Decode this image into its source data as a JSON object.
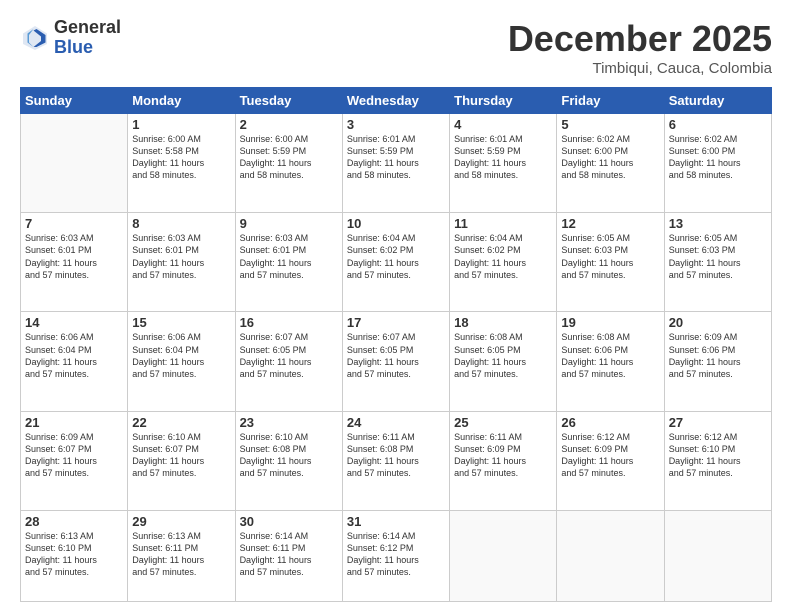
{
  "logo": {
    "general": "General",
    "blue": "Blue"
  },
  "title": "December 2025",
  "subtitle": "Timbiqui, Cauca, Colombia",
  "days_of_week": [
    "Sunday",
    "Monday",
    "Tuesday",
    "Wednesday",
    "Thursday",
    "Friday",
    "Saturday"
  ],
  "weeks": [
    [
      {
        "day": "",
        "info": ""
      },
      {
        "day": "1",
        "info": "Sunrise: 6:00 AM\nSunset: 5:58 PM\nDaylight: 11 hours\nand 58 minutes."
      },
      {
        "day": "2",
        "info": "Sunrise: 6:00 AM\nSunset: 5:59 PM\nDaylight: 11 hours\nand 58 minutes."
      },
      {
        "day": "3",
        "info": "Sunrise: 6:01 AM\nSunset: 5:59 PM\nDaylight: 11 hours\nand 58 minutes."
      },
      {
        "day": "4",
        "info": "Sunrise: 6:01 AM\nSunset: 5:59 PM\nDaylight: 11 hours\nand 58 minutes."
      },
      {
        "day": "5",
        "info": "Sunrise: 6:02 AM\nSunset: 6:00 PM\nDaylight: 11 hours\nand 58 minutes."
      },
      {
        "day": "6",
        "info": "Sunrise: 6:02 AM\nSunset: 6:00 PM\nDaylight: 11 hours\nand 58 minutes."
      }
    ],
    [
      {
        "day": "7",
        "info": "Sunrise: 6:03 AM\nSunset: 6:01 PM\nDaylight: 11 hours\nand 57 minutes."
      },
      {
        "day": "8",
        "info": "Sunrise: 6:03 AM\nSunset: 6:01 PM\nDaylight: 11 hours\nand 57 minutes."
      },
      {
        "day": "9",
        "info": "Sunrise: 6:03 AM\nSunset: 6:01 PM\nDaylight: 11 hours\nand 57 minutes."
      },
      {
        "day": "10",
        "info": "Sunrise: 6:04 AM\nSunset: 6:02 PM\nDaylight: 11 hours\nand 57 minutes."
      },
      {
        "day": "11",
        "info": "Sunrise: 6:04 AM\nSunset: 6:02 PM\nDaylight: 11 hours\nand 57 minutes."
      },
      {
        "day": "12",
        "info": "Sunrise: 6:05 AM\nSunset: 6:03 PM\nDaylight: 11 hours\nand 57 minutes."
      },
      {
        "day": "13",
        "info": "Sunrise: 6:05 AM\nSunset: 6:03 PM\nDaylight: 11 hours\nand 57 minutes."
      }
    ],
    [
      {
        "day": "14",
        "info": "Sunrise: 6:06 AM\nSunset: 6:04 PM\nDaylight: 11 hours\nand 57 minutes."
      },
      {
        "day": "15",
        "info": "Sunrise: 6:06 AM\nSunset: 6:04 PM\nDaylight: 11 hours\nand 57 minutes."
      },
      {
        "day": "16",
        "info": "Sunrise: 6:07 AM\nSunset: 6:05 PM\nDaylight: 11 hours\nand 57 minutes."
      },
      {
        "day": "17",
        "info": "Sunrise: 6:07 AM\nSunset: 6:05 PM\nDaylight: 11 hours\nand 57 minutes."
      },
      {
        "day": "18",
        "info": "Sunrise: 6:08 AM\nSunset: 6:05 PM\nDaylight: 11 hours\nand 57 minutes."
      },
      {
        "day": "19",
        "info": "Sunrise: 6:08 AM\nSunset: 6:06 PM\nDaylight: 11 hours\nand 57 minutes."
      },
      {
        "day": "20",
        "info": "Sunrise: 6:09 AM\nSunset: 6:06 PM\nDaylight: 11 hours\nand 57 minutes."
      }
    ],
    [
      {
        "day": "21",
        "info": "Sunrise: 6:09 AM\nSunset: 6:07 PM\nDaylight: 11 hours\nand 57 minutes."
      },
      {
        "day": "22",
        "info": "Sunrise: 6:10 AM\nSunset: 6:07 PM\nDaylight: 11 hours\nand 57 minutes."
      },
      {
        "day": "23",
        "info": "Sunrise: 6:10 AM\nSunset: 6:08 PM\nDaylight: 11 hours\nand 57 minutes."
      },
      {
        "day": "24",
        "info": "Sunrise: 6:11 AM\nSunset: 6:08 PM\nDaylight: 11 hours\nand 57 minutes."
      },
      {
        "day": "25",
        "info": "Sunrise: 6:11 AM\nSunset: 6:09 PM\nDaylight: 11 hours\nand 57 minutes."
      },
      {
        "day": "26",
        "info": "Sunrise: 6:12 AM\nSunset: 6:09 PM\nDaylight: 11 hours\nand 57 minutes."
      },
      {
        "day": "27",
        "info": "Sunrise: 6:12 AM\nSunset: 6:10 PM\nDaylight: 11 hours\nand 57 minutes."
      }
    ],
    [
      {
        "day": "28",
        "info": "Sunrise: 6:13 AM\nSunset: 6:10 PM\nDaylight: 11 hours\nand 57 minutes."
      },
      {
        "day": "29",
        "info": "Sunrise: 6:13 AM\nSunset: 6:11 PM\nDaylight: 11 hours\nand 57 minutes."
      },
      {
        "day": "30",
        "info": "Sunrise: 6:14 AM\nSunset: 6:11 PM\nDaylight: 11 hours\nand 57 minutes."
      },
      {
        "day": "31",
        "info": "Sunrise: 6:14 AM\nSunset: 6:12 PM\nDaylight: 11 hours\nand 57 minutes."
      },
      {
        "day": "",
        "info": ""
      },
      {
        "day": "",
        "info": ""
      },
      {
        "day": "",
        "info": ""
      }
    ]
  ]
}
